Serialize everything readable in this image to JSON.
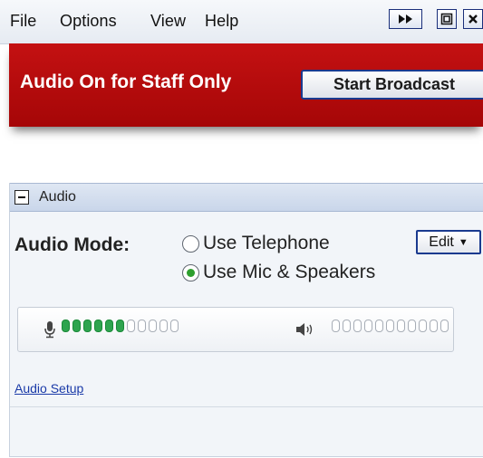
{
  "menu": [
    "File",
    "Options",
    "View",
    "Help"
  ],
  "window_controls": [
    {
      "name": "fast-forward-icon",
      "glyph": "⏩"
    },
    {
      "name": "restore-icon",
      "glyph": "⧉"
    },
    {
      "name": "close-icon",
      "glyph": "✖"
    }
  ],
  "status": {
    "text": "Audio On for Staff Only",
    "button_label": "Start Broadcast",
    "background": "#b80c0d"
  },
  "audio_panel": {
    "title": "Audio",
    "mode_label": "Audio Mode:",
    "options": [
      {
        "label": "Use Telephone",
        "selected": false
      },
      {
        "label": "Use Mic & Speakers",
        "selected": true
      }
    ],
    "edit_label": "Edit",
    "mic_level": {
      "active": 6,
      "total": 11
    },
    "speaker_level": {
      "active": 0,
      "total": 11
    },
    "setup_link": "Audio Setup",
    "meter_color": "#2ea44f"
  }
}
